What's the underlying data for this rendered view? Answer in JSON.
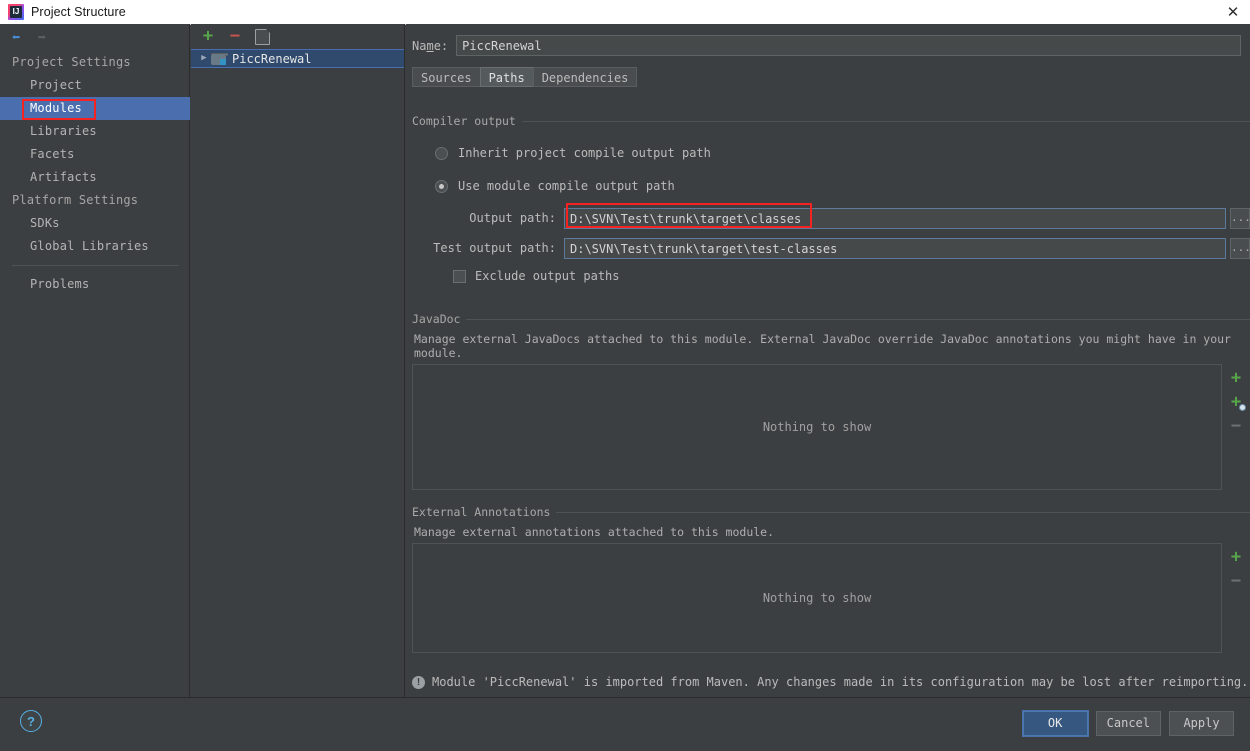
{
  "window": {
    "title": "Project Structure",
    "app_icon": "intellij-idea-icon",
    "close_label": "✕"
  },
  "sidebar": {
    "nav": {
      "back_icon": "←",
      "forward_icon": "→"
    },
    "groups": [
      {
        "label": "Project Settings",
        "items": [
          {
            "label": "Project",
            "selected": false
          },
          {
            "label": "Modules",
            "selected": true
          },
          {
            "label": "Libraries",
            "selected": false
          },
          {
            "label": "Facets",
            "selected": false
          },
          {
            "label": "Artifacts",
            "selected": false
          }
        ]
      },
      {
        "label": "Platform Settings",
        "items": [
          {
            "label": "SDKs",
            "selected": false
          },
          {
            "label": "Global Libraries",
            "selected": false
          }
        ]
      }
    ],
    "problems": {
      "label": "Problems"
    }
  },
  "modules_panel": {
    "toolbar": {
      "add_label": "+",
      "remove_label": "−",
      "copy_icon": "copy-icon"
    },
    "tree": [
      {
        "label": "PiccRenewal",
        "expander": "▶",
        "selected": true
      }
    ]
  },
  "main": {
    "name": {
      "label": "Name:",
      "value": "PiccRenewal"
    },
    "tabs": [
      {
        "label": "Sources",
        "active": false
      },
      {
        "label": "Paths",
        "active": true
      },
      {
        "label": "Dependencies",
        "active": false
      }
    ],
    "compiler_output": {
      "group_title": "Compiler output",
      "inherit_option": {
        "label": "Inherit project compile output path",
        "checked": false
      },
      "module_option": {
        "label": "Use module compile output path",
        "checked": true
      },
      "output_path": {
        "label": "Output path:",
        "value": "D:\\SVN\\Test\\trunk\\target\\classes",
        "browse_label": "..."
      },
      "test_output_path": {
        "label": "Test output path:",
        "value": "D:\\SVN\\Test\\trunk\\target\\test-classes",
        "browse_label": "..."
      },
      "exclude": {
        "label": "Exclude output paths",
        "checked": false
      }
    },
    "javadoc": {
      "group_title": "JavaDoc",
      "description": "Manage external JavaDocs attached to this module. External JavaDoc override JavaDoc annotations you might have in your module.",
      "empty_text": "Nothing to show",
      "actions": {
        "add_label": "+",
        "add_url_label": "+",
        "remove_label": "−"
      }
    },
    "external_annotations": {
      "group_title": "External Annotations",
      "description": "Manage external annotations attached to this module.",
      "empty_text": "Nothing to show",
      "actions": {
        "add_label": "+",
        "remove_label": "−"
      }
    },
    "footer_note": {
      "icon": "info-icon",
      "text": "Module 'PiccRenewal' is imported from Maven. Any changes made in its configuration may be lost after reimporting."
    }
  },
  "bottom": {
    "help_label": "?",
    "buttons": [
      {
        "label": "OK",
        "default": true
      },
      {
        "label": "Cancel",
        "default": false
      },
      {
        "label": "Apply",
        "default": false
      }
    ]
  },
  "colors": {
    "background": "#3c3f41",
    "selection": "#4b6eaf",
    "accent_green": "#57a64a",
    "accent_red": "#c75450",
    "annotation": "#f52222",
    "default_button": "#365880"
  }
}
